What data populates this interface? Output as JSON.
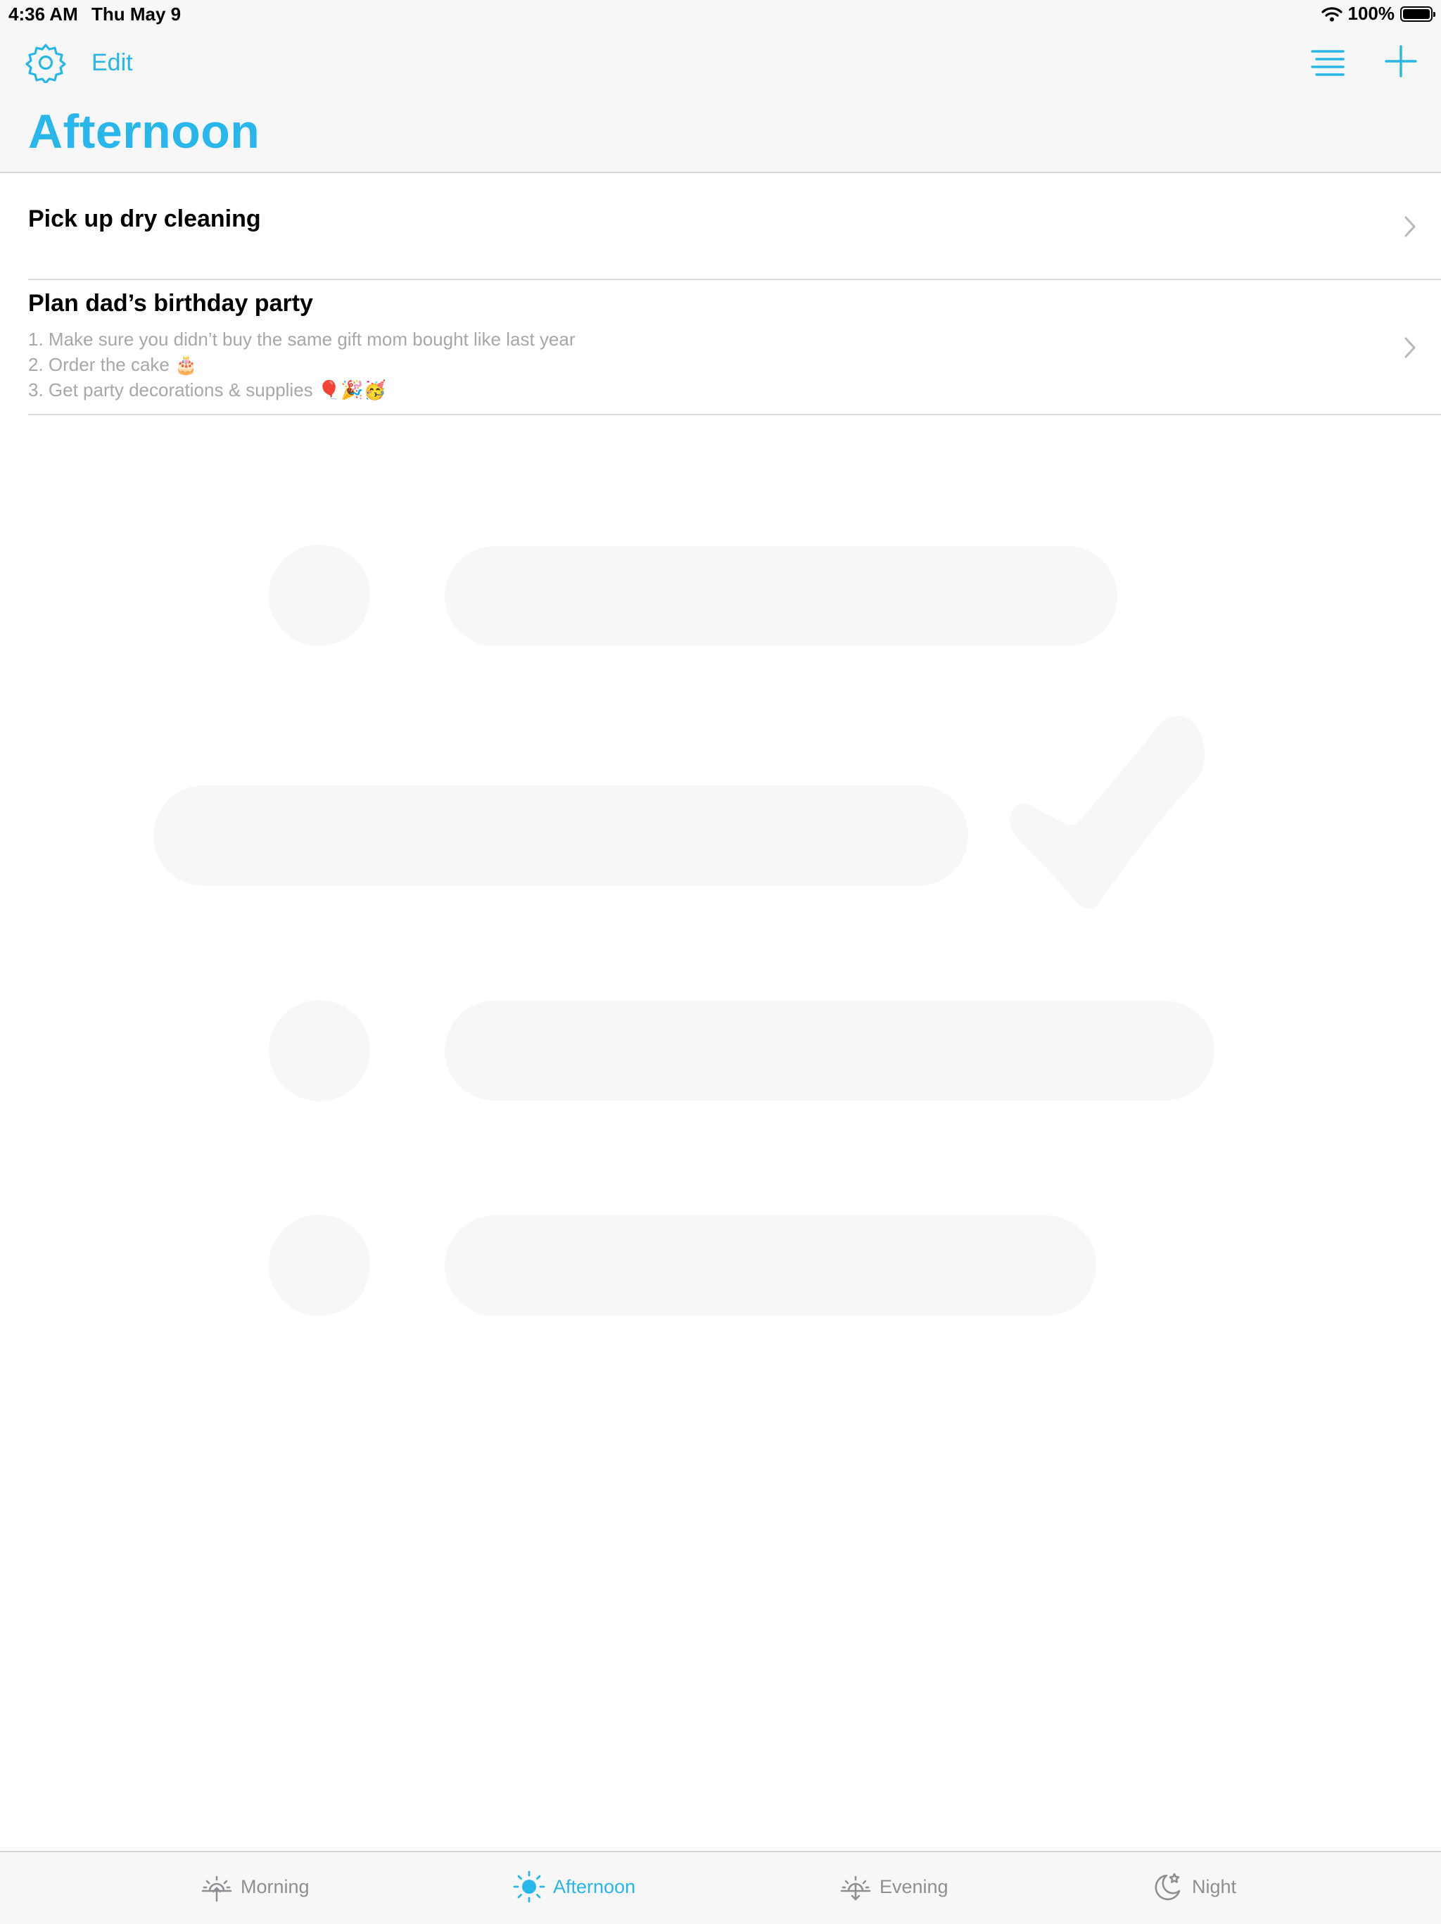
{
  "status_bar": {
    "time": "4:36 AM",
    "date": "Thu May 9",
    "battery": "100%"
  },
  "nav": {
    "edit_label": "Edit",
    "title": "Afternoon",
    "settings_icon": "gear-icon",
    "sort_icon": "list-icon",
    "add_icon": "plus-icon"
  },
  "tasks": [
    {
      "title": "Pick up dry cleaning",
      "notes": []
    },
    {
      "title": "Plan dad’s birthday party",
      "notes": [
        "1. Make sure you didn’t buy the same gift mom bought like last year",
        "2. Order the cake 🎂",
        "3. Get party decorations & supplies 🎈🎉🥳"
      ]
    }
  ],
  "tabs": [
    {
      "label": "Morning",
      "icon": "sunrise-icon",
      "active": false
    },
    {
      "label": "Afternoon",
      "icon": "sun-icon",
      "active": true
    },
    {
      "label": "Evening",
      "icon": "sunset-icon",
      "active": false
    },
    {
      "label": "Night",
      "icon": "moon-icon",
      "active": false
    }
  ],
  "colors": {
    "accent": "#29b6e8",
    "inactive": "#8e8e93",
    "placeholder": "#f7f7f7"
  }
}
